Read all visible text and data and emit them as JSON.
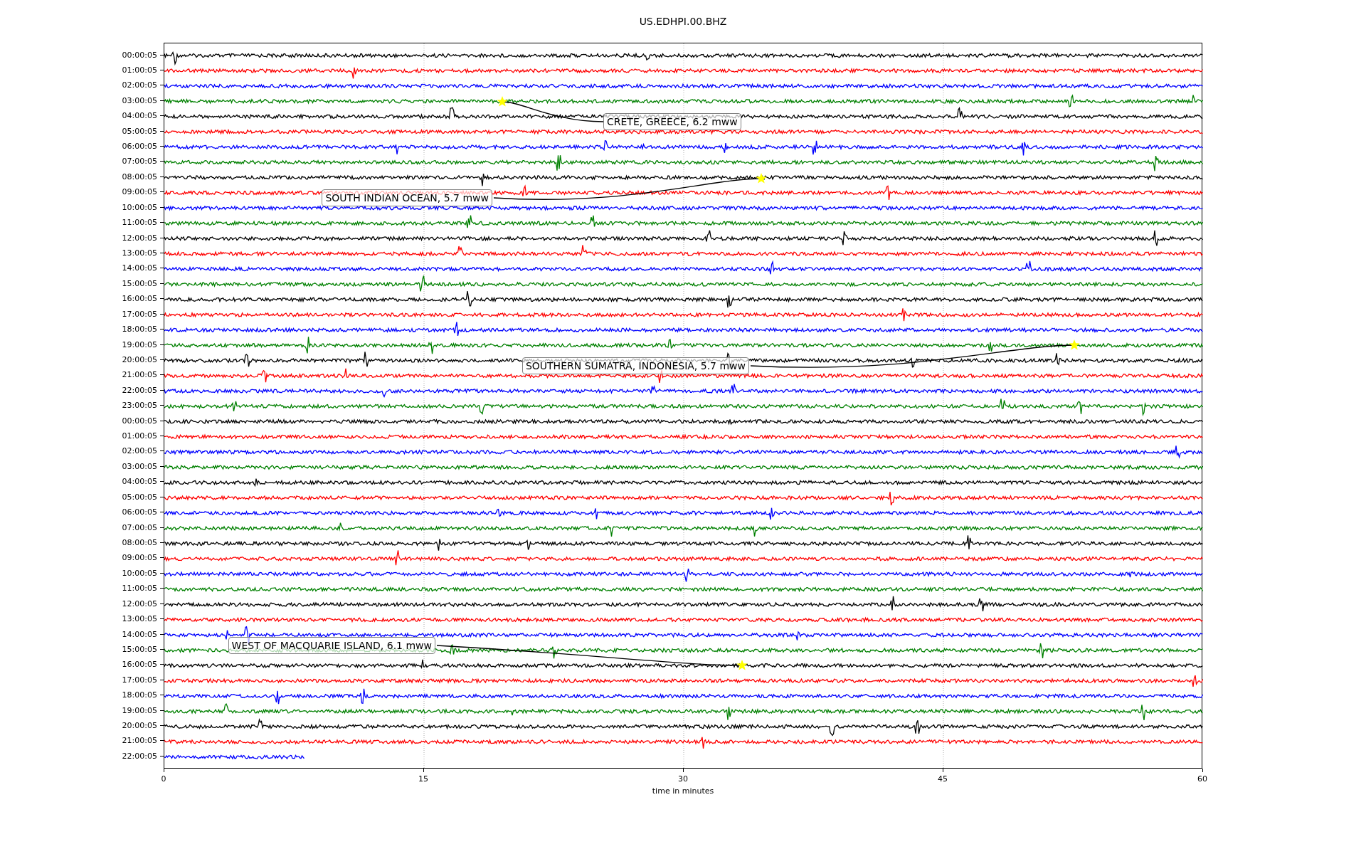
{
  "title": "US.EDHPI.00.BHZ",
  "traces": [
    {
      "label": "00:00:05",
      "color": "#000000",
      "level": 1
    },
    {
      "label": "01:00:05",
      "color": "#ff0000",
      "level": 1
    },
    {
      "label": "02:00:05",
      "color": "#0000ff",
      "level": 1
    },
    {
      "label": "03:00:05",
      "color": "#008000",
      "level": 1
    },
    {
      "label": "04:00:05",
      "color": "#000000",
      "level": 1
    },
    {
      "label": "05:00:05",
      "color": "#ff0000",
      "level": 1
    },
    {
      "label": "06:00:05",
      "color": "#0000ff",
      "level": 1
    },
    {
      "label": "07:00:05",
      "color": "#008000",
      "level": 1
    },
    {
      "label": "08:00:05",
      "color": "#000000",
      "level": 1
    },
    {
      "label": "09:00:05",
      "color": "#ff0000",
      "level": 1
    },
    {
      "label": "10:00:05",
      "color": "#0000ff",
      "level": 1
    },
    {
      "label": "11:00:05",
      "color": "#008000",
      "level": 1
    },
    {
      "label": "12:00:05",
      "color": "#000000",
      "level": 1
    },
    {
      "label": "13:00:05",
      "color": "#ff0000",
      "level": 1
    },
    {
      "label": "14:00:05",
      "color": "#0000ff",
      "level": 1
    },
    {
      "label": "15:00:05",
      "color": "#008000",
      "level": 1
    },
    {
      "label": "16:00:05",
      "color": "#000000",
      "level": 1
    },
    {
      "label": "17:00:05",
      "color": "#ff0000",
      "level": 1
    },
    {
      "label": "18:00:05",
      "color": "#0000ff",
      "level": 1
    },
    {
      "label": "19:00:05",
      "color": "#008000",
      "level": 1
    },
    {
      "label": "20:00:05",
      "color": "#000000",
      "level": 1
    },
    {
      "label": "21:00:05",
      "color": "#ff0000",
      "level": 1
    },
    {
      "label": "22:00:05",
      "color": "#0000ff",
      "level": 1
    },
    {
      "label": "23:00:05",
      "color": "#008000",
      "level": 1
    },
    {
      "label": "00:00:05",
      "color": "#000000",
      "level": 1
    },
    {
      "label": "01:00:05",
      "color": "#ff0000",
      "level": 1
    },
    {
      "label": "02:00:05",
      "color": "#0000ff",
      "level": 1
    },
    {
      "label": "03:00:05",
      "color": "#008000",
      "level": 1
    },
    {
      "label": "04:00:05",
      "color": "#000000",
      "level": 1
    },
    {
      "label": "05:00:05",
      "color": "#ff0000",
      "level": 1
    },
    {
      "label": "06:00:05",
      "color": "#0000ff",
      "level": 1
    },
    {
      "label": "07:00:05",
      "color": "#008000",
      "level": 1
    },
    {
      "label": "08:00:05",
      "color": "#000000",
      "level": 1
    },
    {
      "label": "09:00:05",
      "color": "#ff0000",
      "level": 1
    },
    {
      "label": "10:00:05",
      "color": "#0000ff",
      "level": 1
    },
    {
      "label": "11:00:05",
      "color": "#008000",
      "level": 1
    },
    {
      "label": "12:00:05",
      "color": "#000000",
      "level": 1
    },
    {
      "label": "13:00:05",
      "color": "#ff0000",
      "level": 1
    },
    {
      "label": "14:00:05",
      "color": "#0000ff",
      "level": 1
    },
    {
      "label": "15:00:05",
      "color": "#008000",
      "level": 1
    },
    {
      "label": "16:00:05",
      "color": "#000000",
      "level": 1
    },
    {
      "label": "17:00:05",
      "color": "#ff0000",
      "level": 1
    },
    {
      "label": "18:00:05",
      "color": "#0000ff",
      "level": 1
    },
    {
      "label": "19:00:05",
      "color": "#008000",
      "level": 1
    },
    {
      "label": "20:00:05",
      "color": "#000000",
      "level": 1
    },
    {
      "label": "21:00:05",
      "color": "#ff0000",
      "level": 1
    },
    {
      "label": "22:00:05",
      "color": "#0000ff",
      "level": 0.135
    }
  ],
  "events": [
    {
      "text": "CRETE, GREECE, 6.2 mww"
    },
    {
      "text": "SOUTH INDIAN OCEAN, 5.7 mww"
    },
    {
      "text": "SOUTHERN SUMATRA, INDONESIA, 5.7 mww"
    },
    {
      "text": "WEST OF MACQUARIE ISLAND, 6.1 mww"
    }
  ],
  "x_axis": {
    "ticks": [
      "0",
      "15",
      "30",
      "45",
      "60"
    ],
    "label": "time in minutes"
  }
}
